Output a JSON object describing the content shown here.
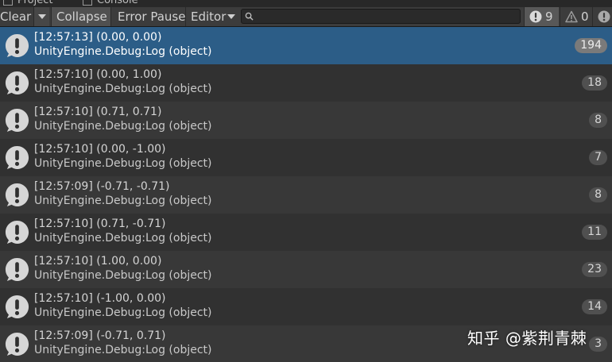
{
  "tabs": [
    {
      "label": "Project"
    },
    {
      "label": "Console"
    }
  ],
  "toolbar": {
    "clear_label": "Clear",
    "collapse_label": "Collapse",
    "error_pause_label": "Error Pause",
    "editor_label": "Editor",
    "search_value": "",
    "info_count": "9",
    "warning_count": "0",
    "error_count": ""
  },
  "colors": {
    "selected_row": "#2c5d87",
    "toolbar_bg": "#3c3c3c"
  },
  "log_entries": [
    {
      "time_value": "[12:57:13] (0.00, 0.00)",
      "source": "UnityEngine.Debug:Log (object)",
      "count": "194"
    },
    {
      "time_value": "[12:57:10] (0.00, 1.00)",
      "source": "UnityEngine.Debug:Log (object)",
      "count": "18"
    },
    {
      "time_value": "[12:57:10] (0.71, 0.71)",
      "source": "UnityEngine.Debug:Log (object)",
      "count": "8"
    },
    {
      "time_value": "[12:57:10] (0.00, -1.00)",
      "source": "UnityEngine.Debug:Log (object)",
      "count": "7"
    },
    {
      "time_value": "[12:57:09] (-0.71, -0.71)",
      "source": "UnityEngine.Debug:Log (object)",
      "count": "8"
    },
    {
      "time_value": "[12:57:10] (0.71, -0.71)",
      "source": "UnityEngine.Debug:Log (object)",
      "count": "11"
    },
    {
      "time_value": "[12:57:10] (1.00, 0.00)",
      "source": "UnityEngine.Debug:Log (object)",
      "count": "23"
    },
    {
      "time_value": "[12:57:10] (-1.00, 0.00)",
      "source": "UnityEngine.Debug:Log (object)",
      "count": "14"
    },
    {
      "time_value": "[12:57:09] (-0.71, 0.71)",
      "source": "UnityEngine.Debug:Log (object)",
      "count": "3"
    }
  ],
  "watermark": "知乎 @紫荆青棘"
}
